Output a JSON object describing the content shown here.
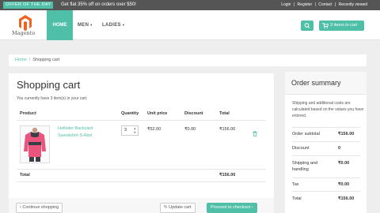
{
  "topbar": {
    "offer_badge": "OFFER OF THE DAY",
    "offer_text": "Get flat 35% off on orders over $50!",
    "links": [
      "Login",
      "Register",
      "Contact",
      "Recently viewed"
    ],
    "separator": "|"
  },
  "brand": {
    "logo_text": "Magento"
  },
  "nav": {
    "items": [
      {
        "label": "HOME",
        "active": true
      },
      {
        "label": "MEN",
        "dropdown": true
      },
      {
        "label": "LADIES",
        "dropdown": true
      }
    ],
    "cart_button": "3 items in cart",
    "search_icon": "search-icon",
    "cart_icon": "shopping-cart-icon"
  },
  "breadcrumb": {
    "home": "Home",
    "separator": "/",
    "current": "Shopping cart"
  },
  "cart": {
    "title": "Shopping cart",
    "subtitle": "You currently have 3 item(s) in your cart.",
    "columns": [
      "Product",
      "Quantity",
      "Unit price",
      "Discount",
      "Total"
    ],
    "rows": [
      {
        "name": "Hollister Backyard Sweatshirt-S-Red",
        "quantity": "3",
        "unit_price": "₹52.00",
        "discount": "₹0.00",
        "total": "₹156.00"
      }
    ],
    "footer_label": "Total",
    "footer_total": "₹156.00",
    "delete_icon": "trash-icon"
  },
  "actions": {
    "continue": "Continue shopping",
    "update": "Update cart",
    "checkout": "Proceed to checkout"
  },
  "summary": {
    "title": "Order summary",
    "note": "Shipping and additional costs are calculated based on the values you have entered.",
    "rows": [
      {
        "label": "Order subtotal",
        "value": "₹156.00"
      },
      {
        "label": "Discount",
        "value": "0"
      },
      {
        "label": "Shipping and handling",
        "value": "₹0.00"
      },
      {
        "label": "Tax",
        "value": "₹0.00"
      },
      {
        "label": "Total",
        "value": "₹156.00"
      }
    ]
  },
  "colors": {
    "accent": "#4fbfa8",
    "topbar": "#555555",
    "background": "#eeeeee"
  }
}
